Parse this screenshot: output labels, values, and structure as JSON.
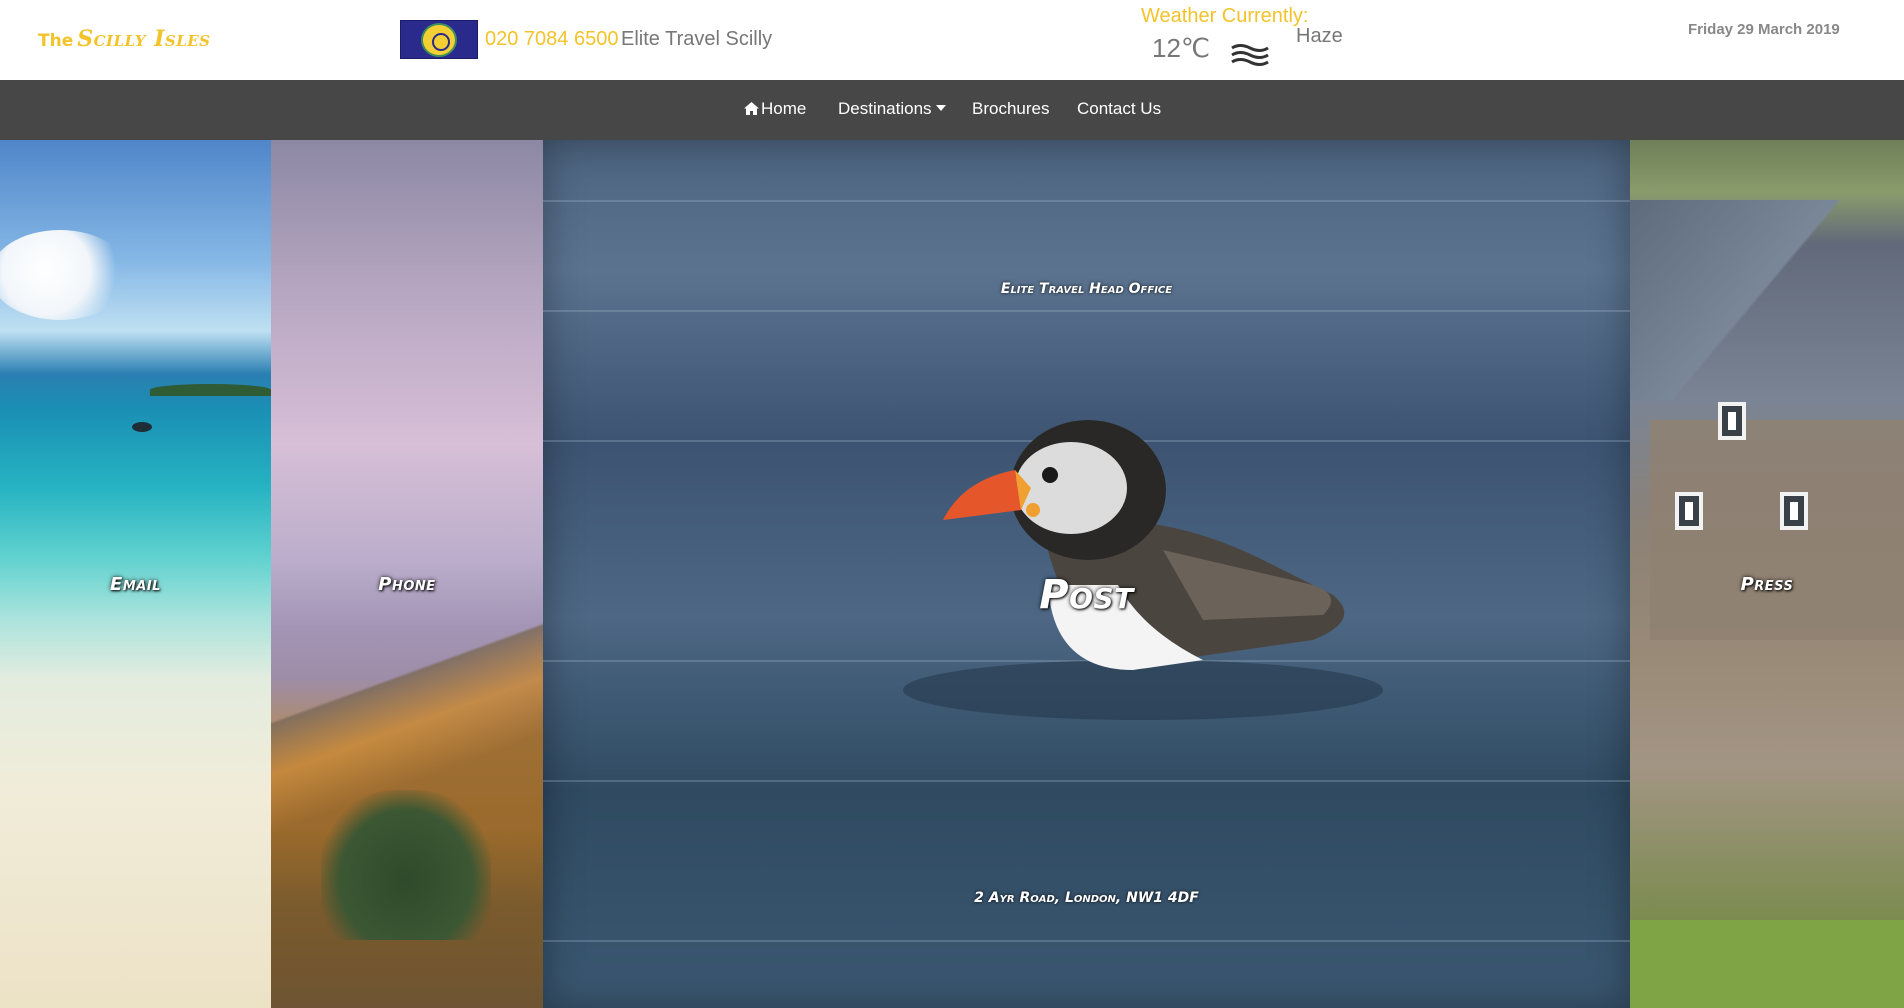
{
  "header": {
    "logo_prefix": "The",
    "logo_name": "Scilly Isles",
    "phone": "020 7084 6500",
    "company": "Elite Travel Scilly",
    "weather_label": "Weather Currently:",
    "temperature": "12℃",
    "condition_icon": "haze-icon",
    "condition": "Haze",
    "date": "Friday 29 March 2019",
    "flag_icon": "scilly-flag-icon"
  },
  "nav": {
    "items": [
      {
        "label": "Home",
        "icon": "home-icon"
      },
      {
        "label": "Destinations",
        "icon": "caret-down-icon"
      },
      {
        "label": "Brochures"
      },
      {
        "label": "Contact Us"
      }
    ]
  },
  "panels": {
    "email": {
      "label": "Email"
    },
    "phone": {
      "label": "Phone"
    },
    "post": {
      "label": "Post",
      "title": "Elite Travel Head Office",
      "address": "2 Ayr Road, London, NW1 4DF"
    },
    "press": {
      "label": "Press"
    }
  },
  "colors": {
    "accent": "#f2c32a",
    "nav_bg": "#474747",
    "muted_text": "#777777"
  }
}
